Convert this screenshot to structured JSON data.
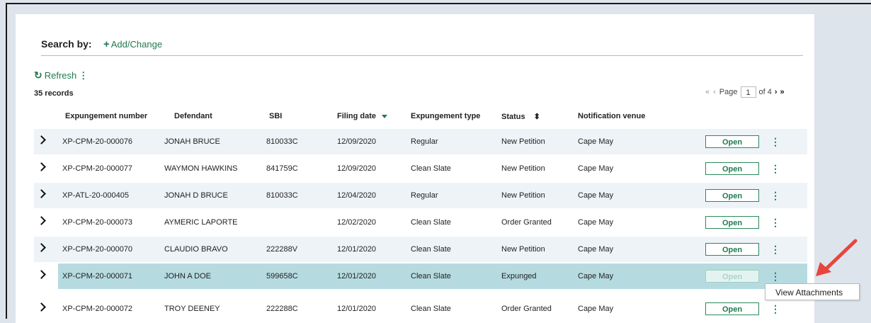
{
  "search": {
    "label": "Search by:",
    "add_change": "Add/Change"
  },
  "toolbar": {
    "refresh_label": "Refresh",
    "records": "35 records"
  },
  "pagination": {
    "page_label": "Page",
    "current_page": "1",
    "of_label": "of 4"
  },
  "table": {
    "headers": [
      "Expungement number",
      "Defendant",
      "SBI",
      "Filing date",
      "Expungement type",
      "Status",
      "Notification venue"
    ],
    "rows": [
      {
        "number": "XP-CPM-20-000076",
        "defendant": "JONAH BRUCE",
        "sbi": "810033C",
        "filing_date": "12/09/2020",
        "type": "Regular",
        "status": "New Petition",
        "venue": "Cape May",
        "action": "Open"
      },
      {
        "number": "XP-CPM-20-000077",
        "defendant": "WAYMON HAWKINS",
        "sbi": "841759C",
        "filing_date": "12/09/2020",
        "type": "Clean Slate",
        "status": "New Petition",
        "venue": "Cape May",
        "action": "Open"
      },
      {
        "number": "XP-ATL-20-000405",
        "defendant": "JONAH D BRUCE",
        "sbi": "810033C",
        "filing_date": "12/04/2020",
        "type": "Regular",
        "status": "New Petition",
        "venue": "Cape May",
        "action": "Open"
      },
      {
        "number": "XP-CPM-20-000073",
        "defendant": "AYMERIC LAPORTE",
        "sbi": "",
        "filing_date": "12/02/2020",
        "type": "Clean Slate",
        "status": "Order Granted",
        "venue": "Cape May",
        "action": "Open"
      },
      {
        "number": "XP-CPM-20-000070",
        "defendant": "CLAUDIO BRAVO",
        "sbi": "222288V",
        "filing_date": "12/01/2020",
        "type": "Clean Slate",
        "status": "New Petition",
        "venue": "Cape May",
        "action": "Open"
      },
      {
        "number": "XP-CPM-20-000071",
        "defendant": "JOHN A DOE",
        "sbi": "599658C",
        "filing_date": "12/01/2020",
        "type": "Clean Slate",
        "status": "Expunged",
        "venue": "Cape May",
        "action": "Open"
      },
      {
        "number": "XP-CPM-20-000072",
        "defendant": "TROY DEENEY",
        "sbi": "222288C",
        "filing_date": "12/01/2020",
        "type": "Clean Slate",
        "status": "Order Granted",
        "venue": "Cape May",
        "action": "Open"
      }
    ]
  },
  "menu": {
    "view_attachments": "View Attachments"
  },
  "colors": {
    "accent": "#1e7b4f",
    "selected_row": "#b5dbe0",
    "annotation_arrow": "#e8453c"
  }
}
